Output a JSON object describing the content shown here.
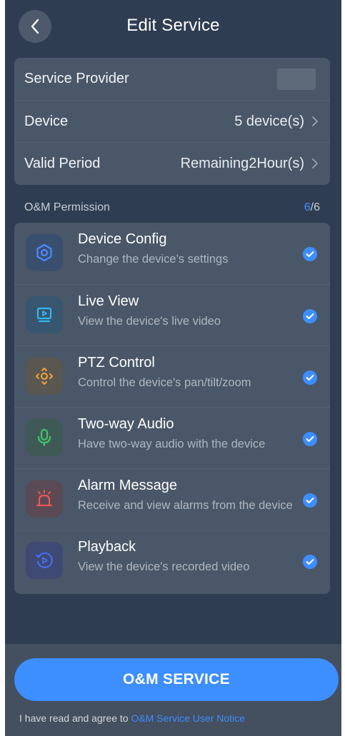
{
  "header": {
    "title": "Edit Service",
    "back_icon": "chevron-left-icon"
  },
  "info": {
    "provider_label": "Service Provider",
    "device_label": "Device",
    "device_value": "5 device(s)",
    "period_label": "Valid Period",
    "period_value": "Remaining2Hour(s)"
  },
  "permissions": {
    "section_label": "O&M Permission",
    "selected_count": "6",
    "total_count": "/6",
    "items": [
      {
        "title": "Device Config",
        "desc": "Change the device's settings",
        "icon": "hexagon-settings-icon",
        "color": "#4a8cff",
        "checked": true
      },
      {
        "title": "Live View",
        "desc": "View the device's live video",
        "icon": "monitor-play-icon",
        "color": "#33b6f5",
        "checked": true
      },
      {
        "title": "PTZ Control",
        "desc": "Control the device's pan/tilt/zoom",
        "icon": "ptz-arrows-icon",
        "color": "#f2a33a",
        "checked": true
      },
      {
        "title": "Two-way Audio",
        "desc": "Have two-way audio with the device",
        "icon": "microphone-icon",
        "color": "#3fc36b",
        "checked": true
      },
      {
        "title": "Alarm Message",
        "desc": "Receive and view alarms from the device",
        "icon": "alarm-light-icon",
        "color": "#f05454",
        "checked": true
      },
      {
        "title": "Playback",
        "desc": "View the device's recorded video",
        "icon": "playback-icon",
        "color": "#4a6cf0",
        "checked": true
      }
    ]
  },
  "footer": {
    "button_label": "O&M SERVICE",
    "agree_prefix": "I have read and agree to ",
    "agree_link": "O&M Service User Notice"
  },
  "colors": {
    "accent": "#3d8eff",
    "background": "#2f3d52",
    "card": "#4a5768"
  }
}
